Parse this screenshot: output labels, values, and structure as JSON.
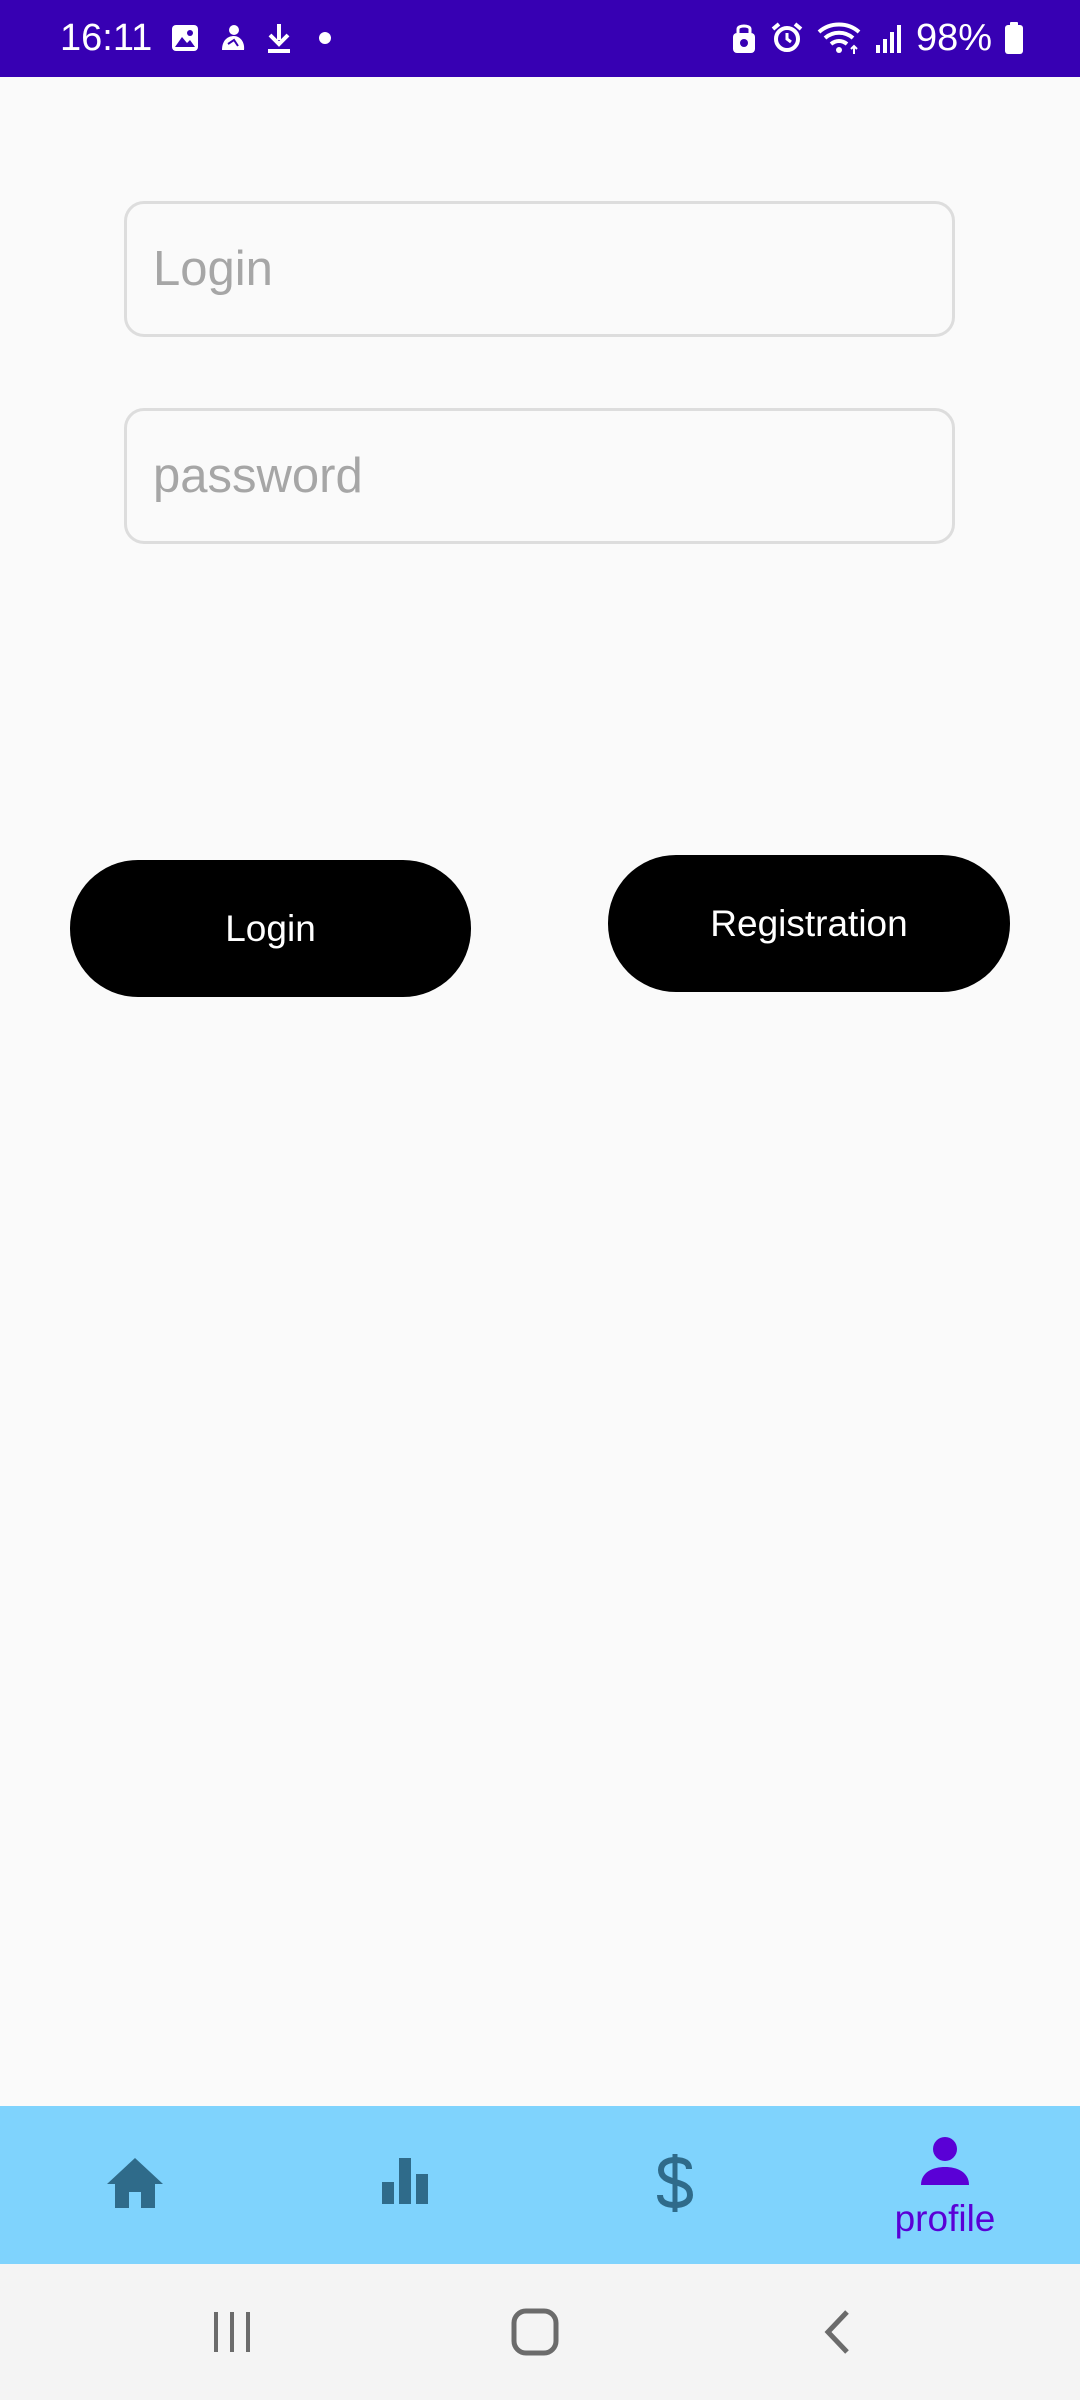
{
  "status_bar": {
    "time": "16:11",
    "battery": "98%",
    "background": "#3700B3",
    "left_icons": [
      "gallery-icon",
      "notification-app-icon",
      "download-icon",
      "dot-icon"
    ],
    "right_icons": [
      "nfc-lock-icon",
      "alarm-icon",
      "wifi-icon",
      "signal-icon",
      "battery-icon"
    ]
  },
  "login_form": {
    "login_placeholder": "Login",
    "login_value": "",
    "password_placeholder": "password",
    "password_value": ""
  },
  "buttons": {
    "login_label": "Login",
    "registration_label": "Registration"
  },
  "bottom_nav": {
    "background": "#7FD3FD",
    "active_color": "#5A00D6",
    "inactive_color": "#2F6B8A",
    "items": [
      {
        "icon": "home-icon",
        "label": "",
        "active": false
      },
      {
        "icon": "bar-chart-icon",
        "label": "",
        "active": false
      },
      {
        "icon": "dollar-icon",
        "label": "",
        "active": false
      },
      {
        "icon": "person-icon",
        "label": "profile",
        "active": true
      }
    ]
  },
  "system_nav": {
    "buttons": [
      "recents-icon",
      "home-button-icon",
      "back-icon"
    ]
  }
}
